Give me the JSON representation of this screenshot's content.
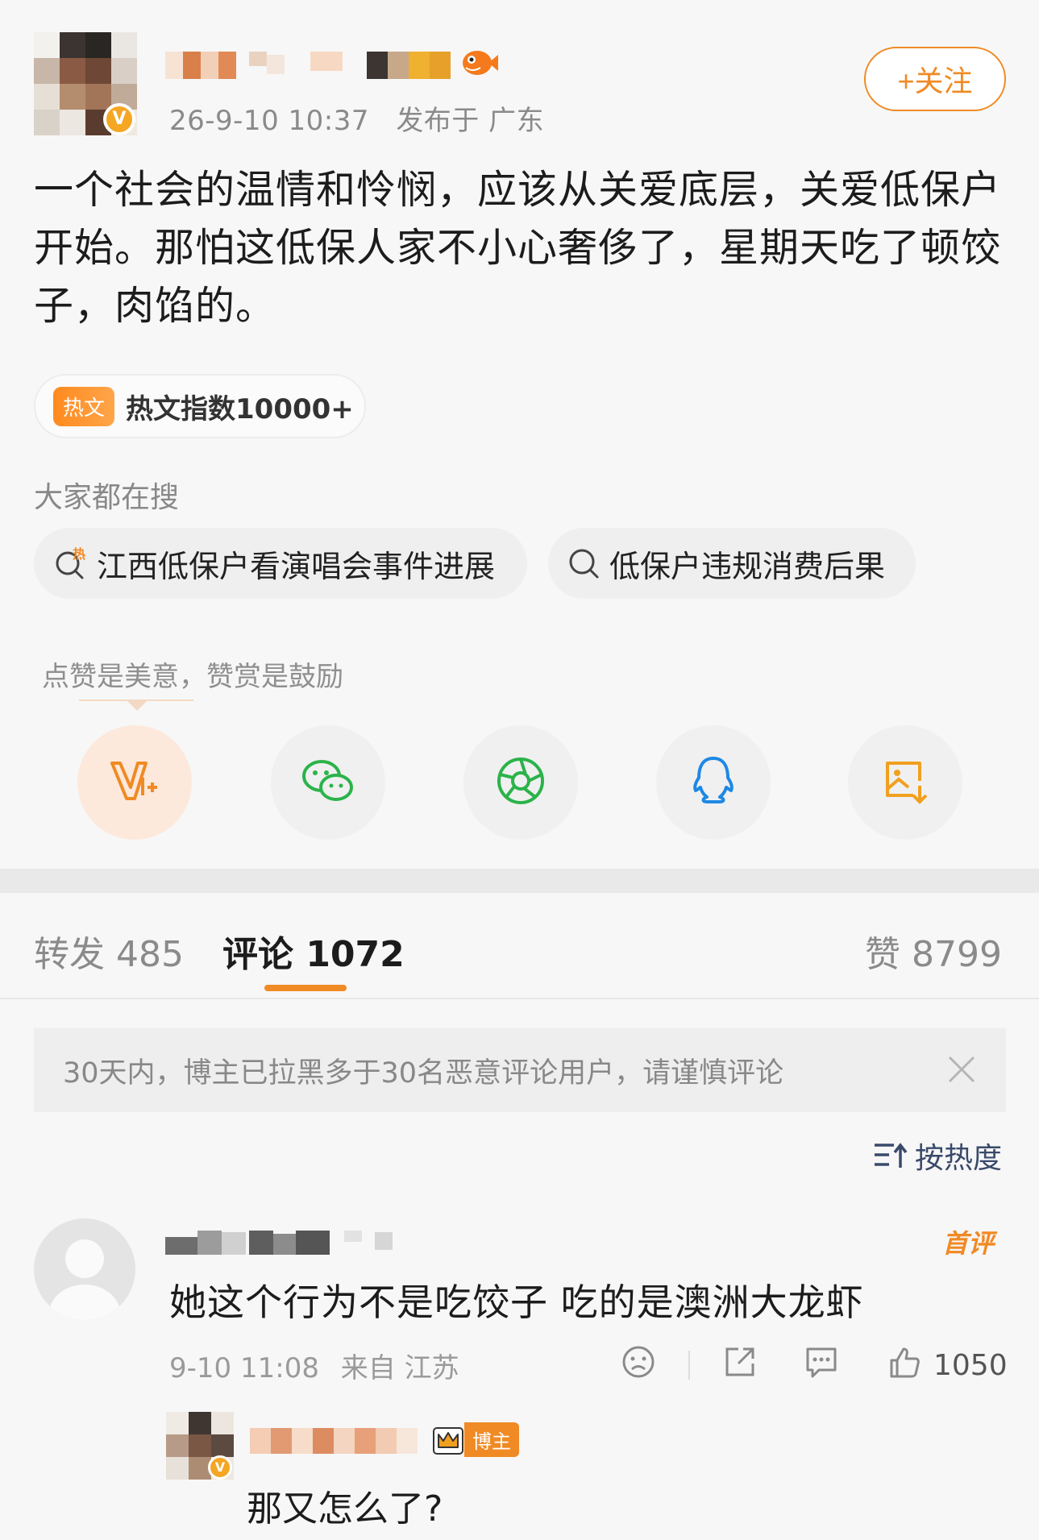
{
  "post": {
    "timestamp": "26-9-10 10:37",
    "location": "发布于 广东",
    "follow_label": "+关注",
    "text": "一个社会的温情和怜悯，应该从关爱底层，关爱低保户开始。那怕这低保人家不小心奢侈了，星期天吃了顿饺子，肉馅的。",
    "verified_mark": "V"
  },
  "hot": {
    "tag": "热文",
    "label": "热文指数10000+"
  },
  "search": {
    "title": "大家都在搜",
    "chips": [
      {
        "label": "江西低保户看演唱会事件进展",
        "hot_mark": "热"
      },
      {
        "label": "低保户违规消费后果"
      }
    ]
  },
  "reward": {
    "text": "点赞是美意，赞赏是鼓励"
  },
  "share": {
    "icons": [
      "reward-icon",
      "wechat-icon",
      "moments-icon",
      "qq-icon",
      "save-image-icon"
    ]
  },
  "tabs": {
    "repost": "转发 485",
    "comment": "评论 1072",
    "like": "赞 8799"
  },
  "notice": {
    "text": "30天内，博主已拉黑多于30名恶意评论用户，请谨慎评论"
  },
  "sort": {
    "label": "按热度"
  },
  "comments": [
    {
      "first_badge": "首评",
      "text": "她这个行为不是吃饺子 吃的是澳洲大龙虾",
      "time": "9-10 11:08",
      "location": "来自 江苏",
      "likes": "1050",
      "reply": {
        "badge": "博主",
        "text": "那又怎么了?"
      }
    }
  ],
  "colors": {
    "accent": "#f08a24",
    "wechat_green": "#2bb34a",
    "qq_blue": "#1e88e5",
    "save_gold": "#f0a020"
  }
}
